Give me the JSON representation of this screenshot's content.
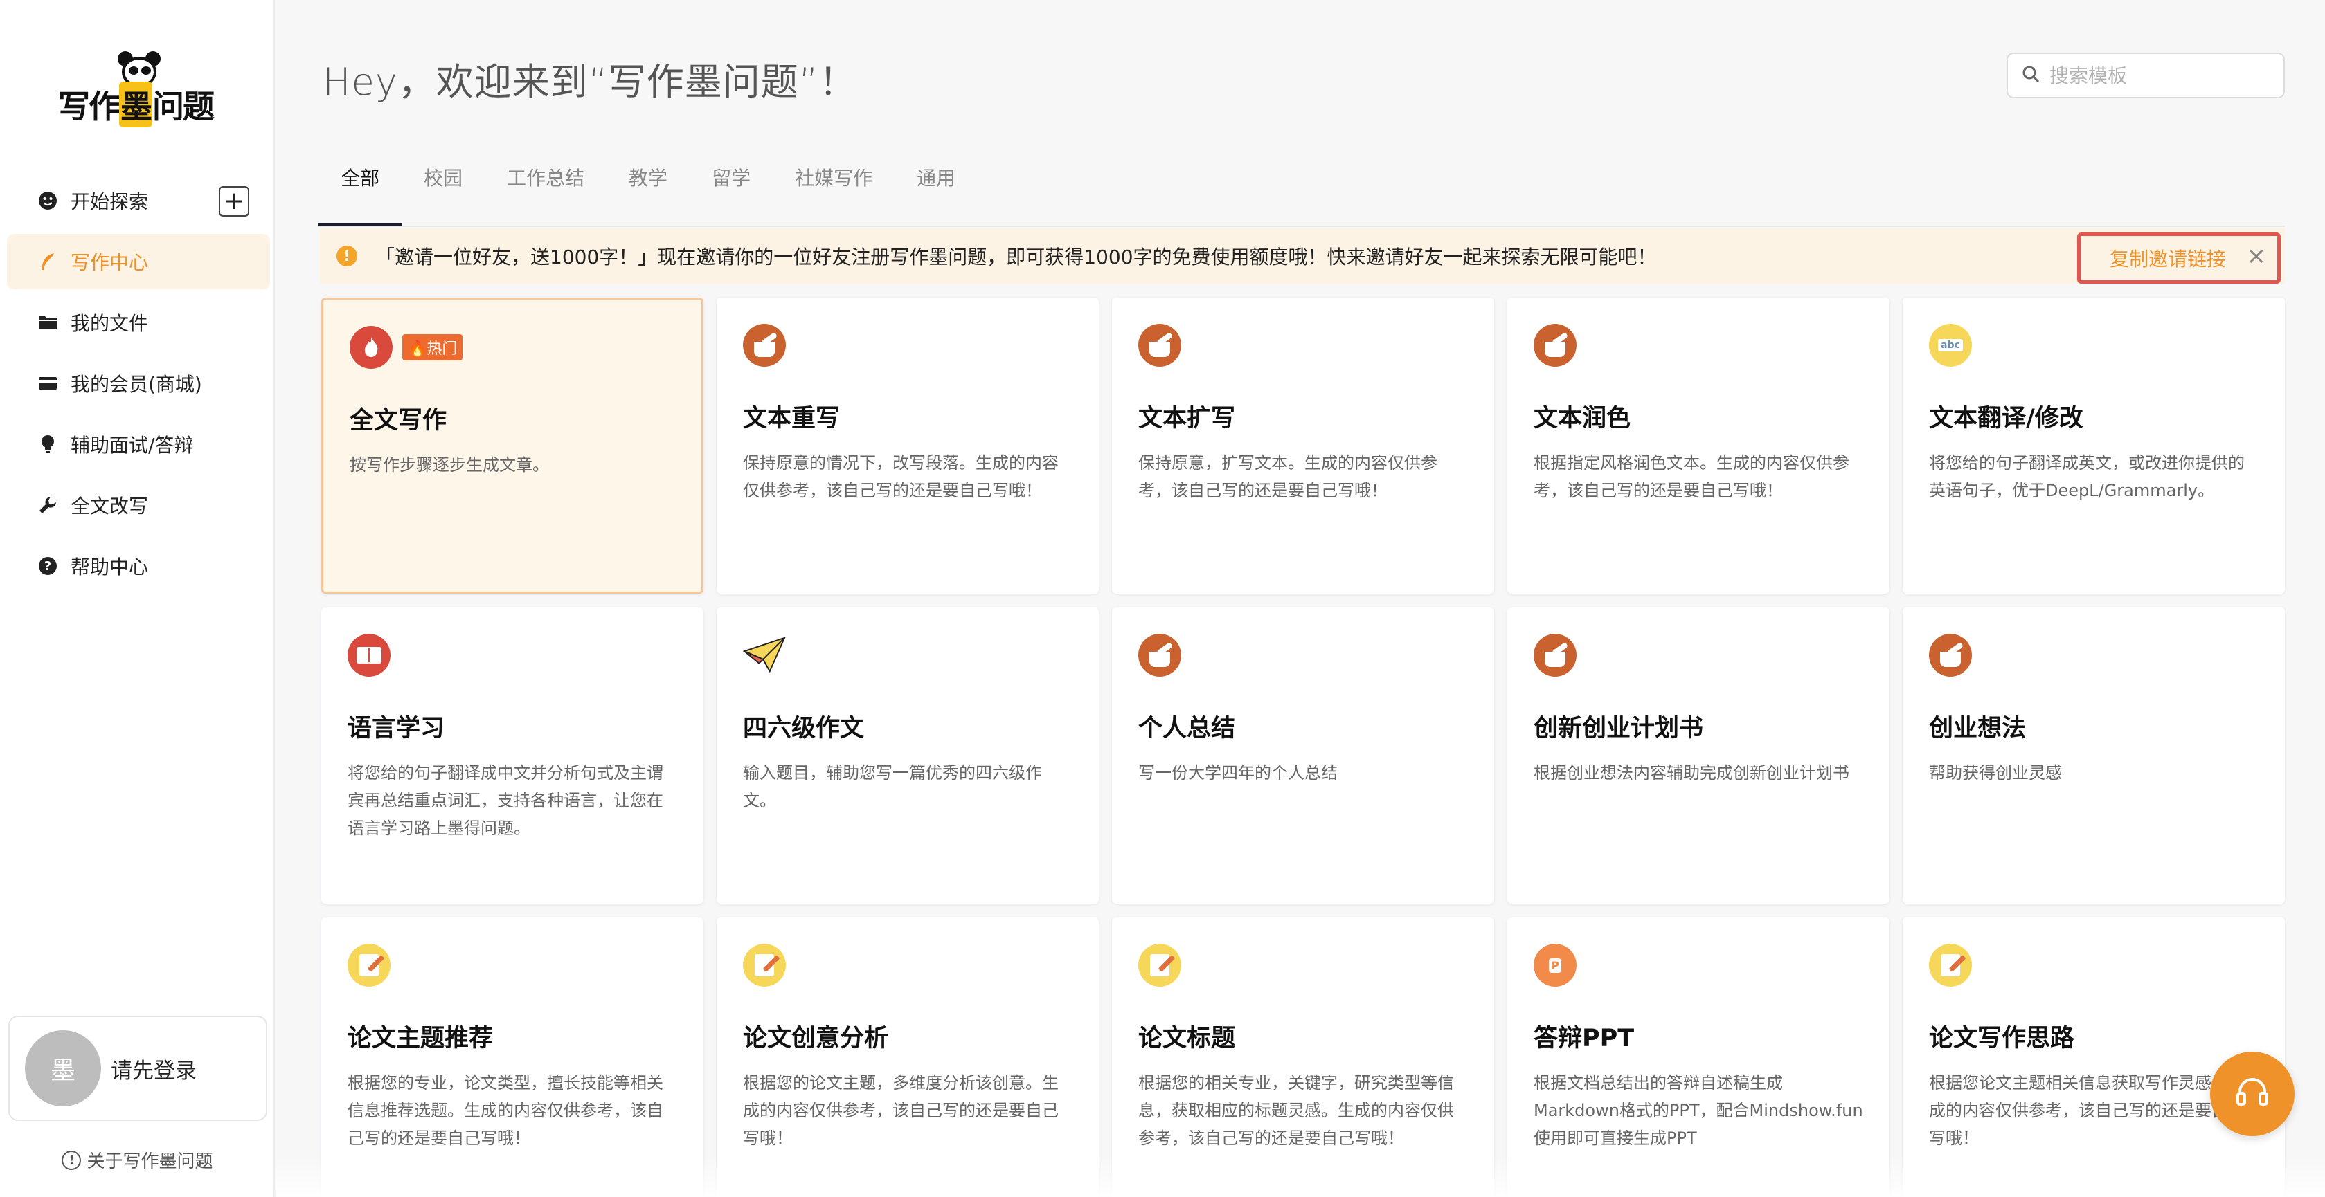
{
  "app": {
    "logo_text_a": "写作",
    "logo_text_b": "墨",
    "logo_text_c": "问题"
  },
  "sidebar": {
    "items": [
      {
        "label": "开始探索",
        "icon": "smile-icon"
      },
      {
        "label": "写作中心",
        "icon": "quill-icon",
        "active": true
      },
      {
        "label": "我的文件",
        "icon": "folder-icon"
      },
      {
        "label": "我的会员(商城)",
        "icon": "card-icon"
      },
      {
        "label": "辅助面试/答辩",
        "icon": "bulb-icon"
      },
      {
        "label": "全文改写",
        "icon": "wrench-icon"
      },
      {
        "label": "帮助中心",
        "icon": "question-icon"
      }
    ],
    "add_symbol": "+",
    "login": {
      "avatar_text": "墨",
      "label": "请先登录"
    },
    "about": "关于写作墨问题"
  },
  "header": {
    "welcome": "Hey，欢迎来到“写作墨问题”！",
    "search_placeholder": "搜索模板"
  },
  "tabs": [
    "全部",
    "校园",
    "工作总结",
    "教学",
    "留学",
    "社媒写作",
    "通用"
  ],
  "notice": {
    "text": "「邀请一位好友，送1000字！」现在邀请你的一位好友注册写作墨问题，即可获得1000字的免费使用额度哦！快来邀请好友一起来探索无限可能吧！",
    "action": "复制邀请链接",
    "close": "×"
  },
  "cards": [
    {
      "title": "全文写作",
      "desc": "按写作步骤逐步生成文章。",
      "badge": "🔥热门",
      "icon": "flame-icon"
    },
    {
      "title": "文本重写",
      "desc": "保持原意的情况下，改写段落。生成的内容仅供参考，该自己写的还是要自己写哦！",
      "icon": "quill-cup-icon"
    },
    {
      "title": "文本扩写",
      "desc": "保持原意，扩写文本。生成的内容仅供参考，该自己写的还是要自己写哦！",
      "icon": "quill-cup-icon"
    },
    {
      "title": "文本润色",
      "desc": "根据指定风格润色文本。生成的内容仅供参考，该自己写的还是要自己写哦！",
      "icon": "quill-cup-icon"
    },
    {
      "title": "文本翻译/修改",
      "desc": "将您给的句子翻译成英文，或改进你提供的英语句子，优于DeepL/Grammarly。",
      "icon": "abc-icon",
      "icon_text": "abc"
    },
    {
      "title": "语言学习",
      "desc": "将您给的句子翻译成中文并分析句式及主谓宾再总结重点词汇，支持各种语言，让您在语言学习路上墨得问题。",
      "icon": "book-icon"
    },
    {
      "title": "四六级作文",
      "desc": "输入题目，辅助您写一篇优秀的四六级作文。",
      "icon": "paper-plane-icon"
    },
    {
      "title": "个人总结",
      "desc": "写一份大学四年的个人总结",
      "icon": "quill-cup-icon"
    },
    {
      "title": "创新创业计划书",
      "desc": "根据创业想法内容辅助完成创新创业计划书",
      "icon": "quill-cup-icon"
    },
    {
      "title": "创业想法",
      "desc": "帮助获得创业灵感",
      "icon": "quill-cup-icon"
    },
    {
      "title": "论文主题推荐",
      "desc": "根据您的专业，论文类型，擅长技能等相关信息推荐选题。生成的内容仅供参考，该自己写的还是要自己写哦！",
      "icon": "note-pencil-icon"
    },
    {
      "title": "论文创意分析",
      "desc": "根据您的论文主题，多维度分析该创意。生成的内容仅供参考，该自己写的还是要自己写哦！",
      "icon": "note-pencil-icon"
    },
    {
      "title": "论文标题",
      "desc": "根据您的相关专业，关键字，研究类型等信息，获取相应的标题灵感。生成的内容仅供参考，该自己写的还是要自己写哦！",
      "icon": "note-pencil-icon"
    },
    {
      "title": "答辩PPT",
      "desc": "根据文档总结出的答辩自述稿生成Markdown格式的PPT，配合Mindshow.fun使用即可直接生成PPT",
      "icon": "ppt-icon",
      "icon_text": "P"
    },
    {
      "title": "论文写作思路",
      "desc": "根据您论文主题相关信息获取写作灵感。生成的内容仅供参考，该自己写的还是要自己写哦！",
      "icon": "note-pencil-icon"
    }
  ],
  "colors": {
    "accent": "#f0922a",
    "active_bg": "#fdf3e4",
    "invite_border": "#e2564f"
  }
}
